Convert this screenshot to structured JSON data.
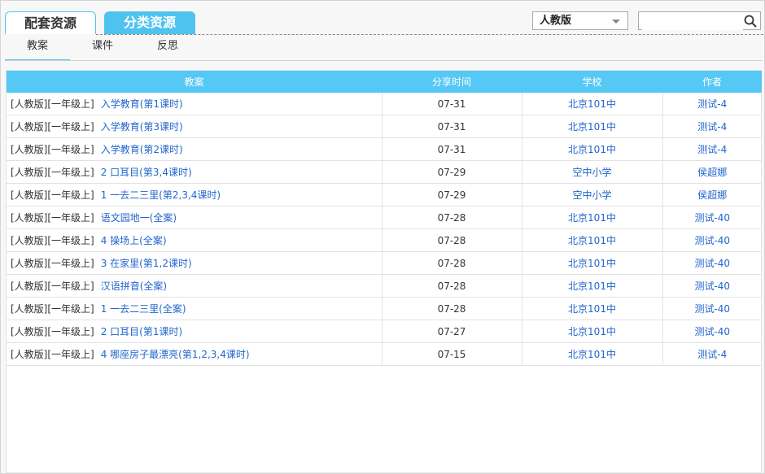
{
  "top_tabs": [
    {
      "label": "配套资源"
    },
    {
      "label": "分类资源"
    }
  ],
  "version_select": {
    "selected": "人教版"
  },
  "search": {
    "value": "",
    "placeholder": ""
  },
  "sub_tabs": [
    {
      "label": "教案"
    },
    {
      "label": "课件"
    },
    {
      "label": "反思"
    }
  ],
  "table": {
    "headers": [
      "教案",
      "分享时间",
      "学校",
      "作者"
    ],
    "rows": [
      {
        "prefix": "[人教版][一年级上]",
        "title": "入学教育(第1课时)",
        "date": "07-31",
        "school": "北京101中",
        "author": "测试-4"
      },
      {
        "prefix": "[人教版][一年级上]",
        "title": "入学教育(第3课时)",
        "date": "07-31",
        "school": "北京101中",
        "author": "测试-4"
      },
      {
        "prefix": "[人教版][一年级上]",
        "title": "入学教育(第2课时)",
        "date": "07-31",
        "school": "北京101中",
        "author": "测试-4"
      },
      {
        "prefix": "[人教版][一年级上]",
        "title": "2 口耳目(第3,4课时)",
        "date": "07-29",
        "school": "空中小学",
        "author": "侯超娜"
      },
      {
        "prefix": "[人教版][一年级上]",
        "title": "1 一去二三里(第2,3,4课时)",
        "date": "07-29",
        "school": "空中小学",
        "author": "侯超娜"
      },
      {
        "prefix": "[人教版][一年级上]",
        "title": "语文园地一(全案)",
        "date": "07-28",
        "school": "北京101中",
        "author": "测试-40"
      },
      {
        "prefix": "[人教版][一年级上]",
        "title": "4 操场上(全案)",
        "date": "07-28",
        "school": "北京101中",
        "author": "测试-40"
      },
      {
        "prefix": "[人教版][一年级上]",
        "title": "3 在家里(第1,2课时)",
        "date": "07-28",
        "school": "北京101中",
        "author": "测试-40"
      },
      {
        "prefix": "[人教版][一年级上]",
        "title": "汉语拼音(全案)",
        "date": "07-28",
        "school": "北京101中",
        "author": "测试-40"
      },
      {
        "prefix": "[人教版][一年级上]",
        "title": "1 一去二三里(全案)",
        "date": "07-28",
        "school": "北京101中",
        "author": "测试-40"
      },
      {
        "prefix": "[人教版][一年级上]",
        "title": "2 口耳目(第1课时)",
        "date": "07-27",
        "school": "北京101中",
        "author": "测试-40"
      },
      {
        "prefix": "[人教版][一年级上]",
        "title": "4 哪座房子最漂亮(第1,2,3,4课时)",
        "date": "07-15",
        "school": "北京101中",
        "author": "测试-4"
      }
    ]
  },
  "colors": {
    "accent": "#4fc3f0",
    "header_bg": "#56c8f5",
    "link": "#2266cc"
  }
}
